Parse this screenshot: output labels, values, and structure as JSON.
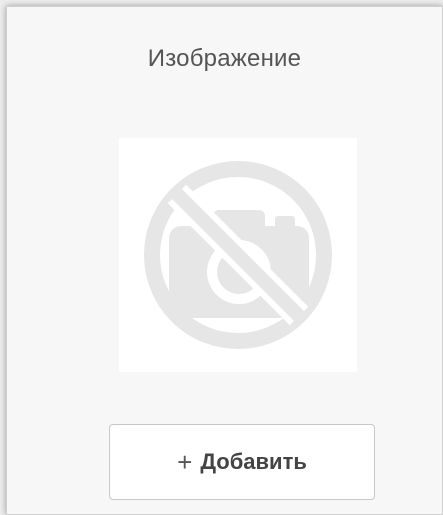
{
  "panel": {
    "title": "Изображение",
    "placeholder_icon": "no-photo-icon",
    "add_button": {
      "icon": "plus-icon",
      "icon_glyph": "+",
      "label": "Добавить"
    }
  },
  "colors": {
    "panel_background": "#f7f7f7",
    "icon_gray": "#e6e6e6",
    "text": "#555555"
  }
}
